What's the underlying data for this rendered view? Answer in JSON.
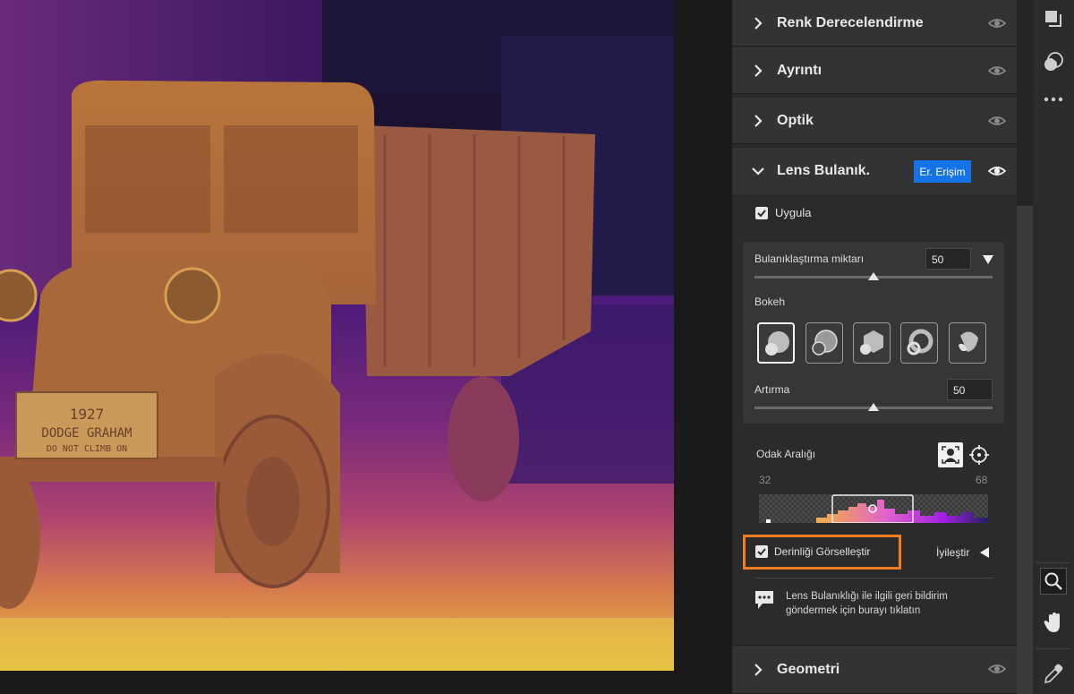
{
  "panel": {
    "sections": {
      "color_grading": "Renk Derecelendirme",
      "detail": "Ayrıntı",
      "optics": "Optik",
      "lens_blur": "Lens Bulanık.",
      "geometry": "Geometri"
    },
    "early_access_badge": "Er. Erişim",
    "apply_label": "Uygula",
    "blur_amount_label": "Bulanıklaştırma miktarı",
    "blur_amount_value": "50",
    "bokeh_label": "Bokeh",
    "boost_label": "Artırma",
    "boost_value": "50",
    "focus_range_label": "Odak Aralığı",
    "focus_min": "32",
    "focus_max": "68",
    "visualize_depth_label": "Derinliği Görselleştir",
    "refine_label": "İyileştir",
    "feedback_text_line1": "Lens Bulanıklığı ile ilgili geri bildirim",
    "feedback_text_line2": "göndermek için burayı tıklatın"
  },
  "photo": {
    "plate_line1": "1927",
    "plate_line2": "DODGE GRAHAM",
    "plate_line3": "DO NOT CLIMB ON"
  },
  "colors": {
    "accent_blue": "#1473e6",
    "highlight_orange": "#f07d22"
  },
  "icons": [
    "chevron-right-icon",
    "chevron-down-icon",
    "eye-icon",
    "layers-icon",
    "masking-icon",
    "more-icon",
    "zoom-icon",
    "hand-icon",
    "eyedropper-icon",
    "subject-focus-icon",
    "target-icon",
    "feedback-icon"
  ]
}
